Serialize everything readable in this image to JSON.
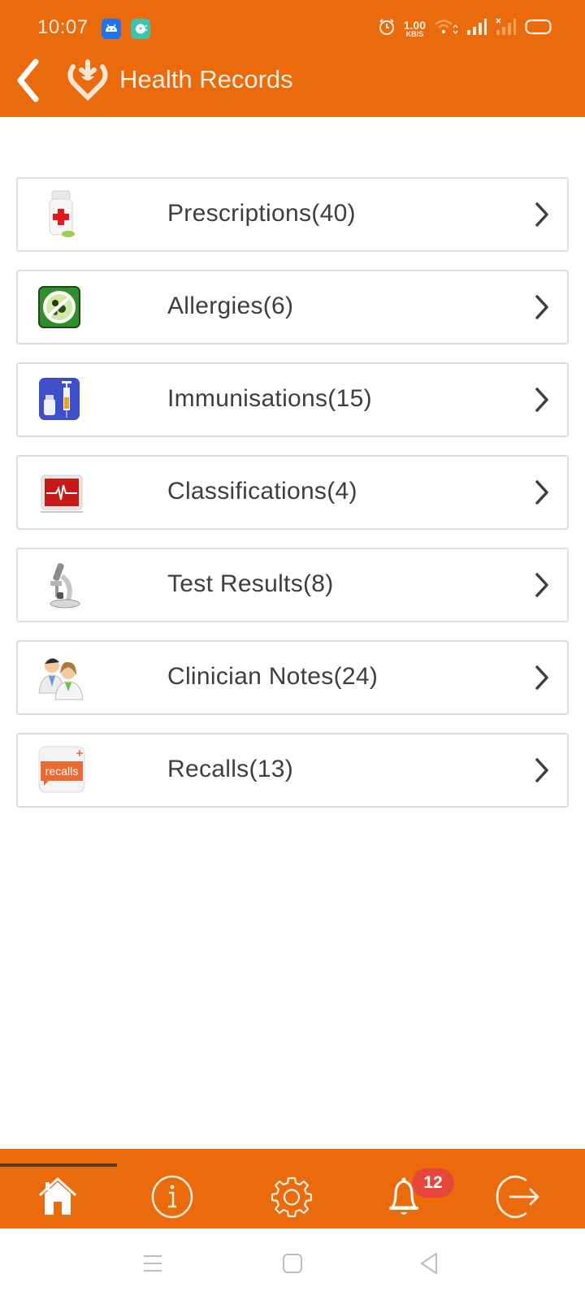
{
  "status_bar": {
    "time": "10:07",
    "notification_icons": [
      "android-icon",
      "app-notification-icon"
    ],
    "net_speed_value": "1.00",
    "net_speed_unit": "KB/S",
    "right_icons": [
      "alarm-icon",
      "wifi-icon",
      "signal-icon",
      "signal-no-sim-icon",
      "battery-icon"
    ]
  },
  "header": {
    "back_icon": "chevron-left-icon",
    "logo_icon": "health-heart-logo",
    "title": "Health Records"
  },
  "records": [
    {
      "icon": "prescription-bottle-icon",
      "label": "Prescriptions(40)"
    },
    {
      "icon": "allergy-icon",
      "label": "Allergies(6)"
    },
    {
      "icon": "immunisation-syringe-icon",
      "label": "Immunisations(15)"
    },
    {
      "icon": "heart-monitor-icon",
      "label": "Classifications(4)"
    },
    {
      "icon": "microscope-icon",
      "label": "Test Results(8)"
    },
    {
      "icon": "clinicians-icon",
      "label": "Clinician Notes(24)"
    },
    {
      "icon": "recalls-icon",
      "label": "Recalls(13)",
      "icon_text": "recalls"
    }
  ],
  "bottom_nav": {
    "items": [
      {
        "name": "home",
        "icon": "home-icon",
        "active": true
      },
      {
        "name": "info",
        "icon": "info-icon",
        "active": false
      },
      {
        "name": "settings",
        "icon": "gear-icon",
        "active": false
      },
      {
        "name": "notifications",
        "icon": "bell-icon",
        "active": false,
        "badge": "12"
      },
      {
        "name": "logout",
        "icon": "logout-icon",
        "active": false
      }
    ]
  },
  "system_nav": [
    "menu-icon",
    "home-square-icon",
    "back-triangle-icon"
  ],
  "colors": {
    "brand_orange": "#EB6A0B",
    "badge_red": "#E8453C",
    "text_dark": "#3E3E3E"
  }
}
